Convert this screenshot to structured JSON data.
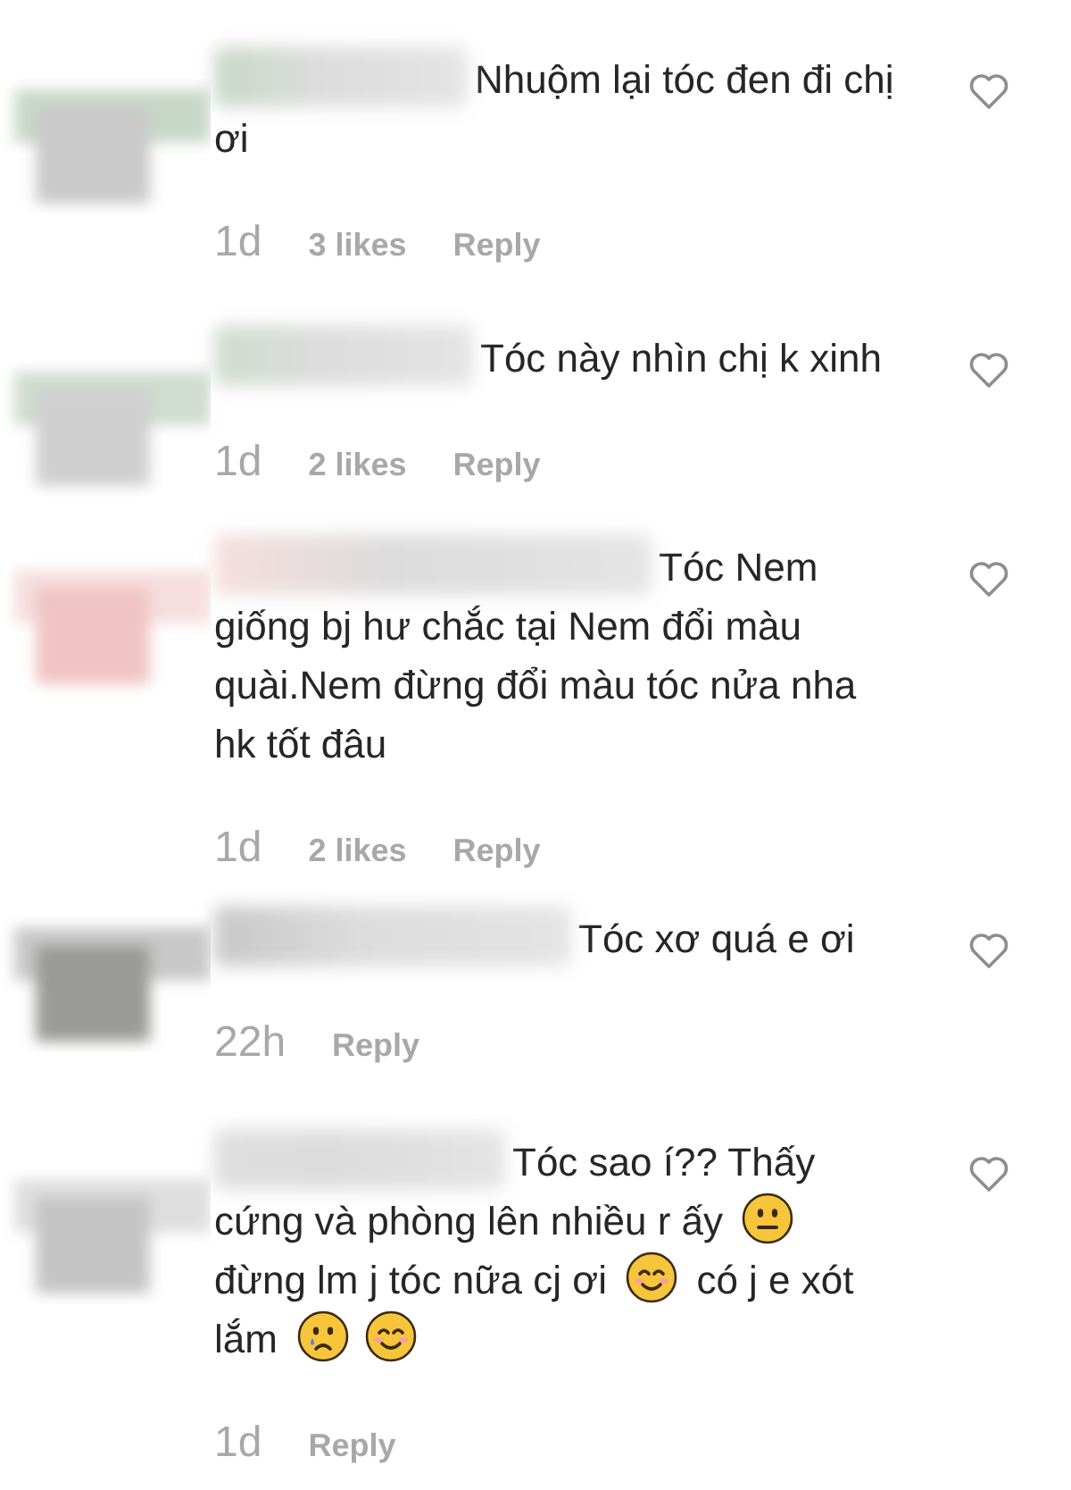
{
  "comments": [
    {
      "parts": [
        {
          "kind": "text",
          "text": "Nhuộm lại tóc đen đi chị ơi"
        }
      ],
      "time": "1d",
      "likes": "3 likes",
      "reply": "Reply"
    },
    {
      "parts": [
        {
          "kind": "text",
          "text": "Tóc này nhìn chị k xinh"
        }
      ],
      "time": "1d",
      "likes": "2 likes",
      "reply": "Reply"
    },
    {
      "parts": [
        {
          "kind": "text",
          "text": "Tóc Nem giống bj hư chắc tại Nem đổi màu quài.Nem đừng đổi màu tóc nửa nha hk tốt đâu"
        }
      ],
      "time": "1d",
      "likes": "2 likes",
      "reply": "Reply"
    },
    {
      "parts": [
        {
          "kind": "text",
          "text": "Tóc xơ quá e ơi"
        }
      ],
      "time": "22h",
      "reply": "Reply"
    },
    {
      "parts": [
        {
          "kind": "text",
          "text": "Tóc sao í?? Thấy cứng và phòng lên nhiều r ấy"
        },
        {
          "kind": "neutral_emoji"
        },
        {
          "kind": "text",
          "text": "đừng lm j tóc nữa cj ơi"
        },
        {
          "kind": "smile_emoji"
        },
        {
          "kind": "text",
          "text": "có j e xót lắm"
        },
        {
          "kind": "cry_emoji"
        },
        {
          "kind": "smile_emoji"
        }
      ],
      "time": "1d",
      "reply": "Reply"
    }
  ]
}
